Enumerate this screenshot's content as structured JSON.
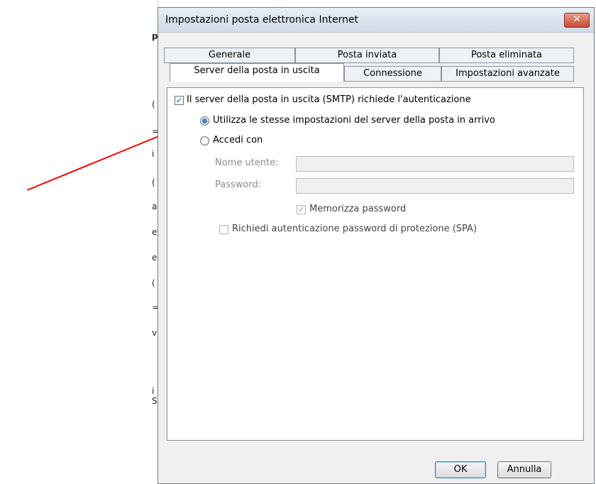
{
  "dialog": {
    "title": "Impostazioni posta elettronica Internet",
    "close_label": "✕"
  },
  "tabs": {
    "row1": [
      "Generale",
      "Posta inviata",
      "Posta eliminata"
    ],
    "row2": [
      "Server della posta in uscita",
      "Connessione",
      "Impostazioni avanzate"
    ],
    "active": "Server della posta in uscita"
  },
  "outgoing": {
    "auth_required_label": "Il server della posta in uscita (SMTP) richiede l'autenticazione",
    "auth_required_checked": true,
    "use_same_label": "Utilizza le stesse impostazioni del server della posta in arrivo",
    "use_same_selected": true,
    "login_with_label": "Accedi con",
    "username_label": "Nome utente:",
    "username_value": "",
    "password_label": "Password:",
    "password_value": "",
    "remember_label": "Memorizza password",
    "remember_checked": true,
    "spa_label": "Richiedi autenticazione password di protezione (SPA)",
    "spa_checked": false
  },
  "buttons": {
    "ok": "OK",
    "cancel": "Annulla"
  },
  "annotation": {
    "arrow_color": "#ff0000"
  }
}
